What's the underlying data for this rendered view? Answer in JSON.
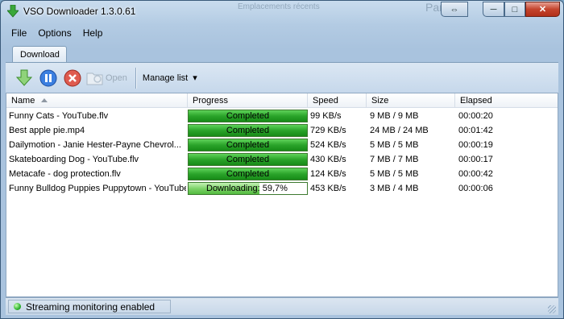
{
  "window": {
    "title": "VSO Downloader 1.3.0.61",
    "background_text_1": "Emplacements récents",
    "background_text_2": "Pan",
    "caption_glyphs": {
      "restore2": "⇔",
      "minimize": "─",
      "maximize": "□",
      "close": "✕"
    }
  },
  "menu": [
    "File",
    "Options",
    "Help"
  ],
  "tabs": [
    {
      "label": "Download",
      "selected": true
    }
  ],
  "toolbar": {
    "open_label": "Open",
    "manage_label": "Manage list",
    "manage_arrow": "▾"
  },
  "columns": {
    "name": "Name",
    "progress": "Progress",
    "speed": "Speed",
    "size": "Size",
    "elapsed": "Elapsed"
  },
  "rows": [
    {
      "name": "Funny Cats - YouTube.flv",
      "progress": 1.0,
      "progress_text": "Completed",
      "speed": "99 KB/s",
      "size": "9 MB / 9 MB",
      "elapsed": "00:00:20"
    },
    {
      "name": "Best apple pie.mp4",
      "progress": 1.0,
      "progress_text": "Completed",
      "speed": "729 KB/s",
      "size": "24 MB / 24 MB",
      "elapsed": "00:01:42"
    },
    {
      "name": "Dailymotion - Janie Hester-Payne Chevrol...",
      "progress": 1.0,
      "progress_text": "Completed",
      "speed": "524 KB/s",
      "size": "5 MB / 5 MB",
      "elapsed": "00:00:19"
    },
    {
      "name": "Skateboarding Dog - YouTube.flv",
      "progress": 1.0,
      "progress_text": "Completed",
      "speed": "430 KB/s",
      "size": "7 MB / 7 MB",
      "elapsed": "00:00:17"
    },
    {
      "name": "Metacafe - dog protection.flv",
      "progress": 1.0,
      "progress_text": "Completed",
      "speed": "124 KB/s",
      "size": "5 MB / 5 MB",
      "elapsed": "00:00:42"
    },
    {
      "name": "Funny Bulldog Puppies Puppytown - YouTube",
      "progress": 0.597,
      "progress_text": "Downloading: 59,7%",
      "speed": "453 KB/s",
      "size": "3 MB / 4 MB",
      "elapsed": "00:00:06"
    }
  ],
  "status": {
    "text": "Streaming monitoring enabled"
  },
  "colors": {
    "progress_green": "#2aa42a",
    "progress_light": "#7ed36a",
    "stop_red": "#d9443a",
    "pause_blue": "#2f6fd6",
    "download_green": "#5cb84a"
  }
}
